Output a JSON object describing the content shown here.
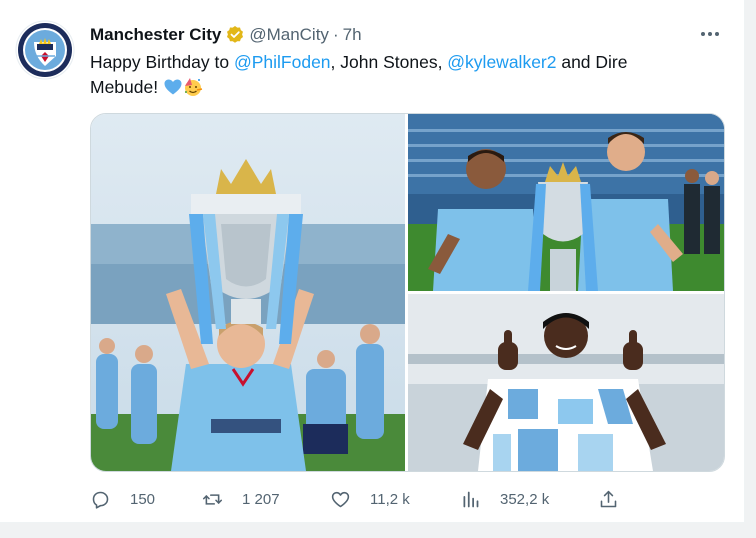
{
  "author": {
    "name": "Manchester City",
    "handle": "@ManCity",
    "separator": "·",
    "time": "7h"
  },
  "tweet": {
    "prefix": "Happy Birthday to ",
    "mention1": "@PhilFoden",
    "middle": ", John Stones, ",
    "mention2": "@kylewalker2",
    "suffix": " and Dire Mebude!"
  },
  "media": {
    "photos": [
      "foden-trophy-photo",
      "walker-stones-trophy-photo",
      "mebude-thumbs-up-photo"
    ]
  },
  "actions": {
    "replies": "150",
    "retweets": "1 207",
    "likes": "11,2 k",
    "views": "352,2 k"
  },
  "colors": {
    "accent": "#1d9bf0",
    "verified": "#e2b719",
    "city_blue": "#6cabdd"
  }
}
